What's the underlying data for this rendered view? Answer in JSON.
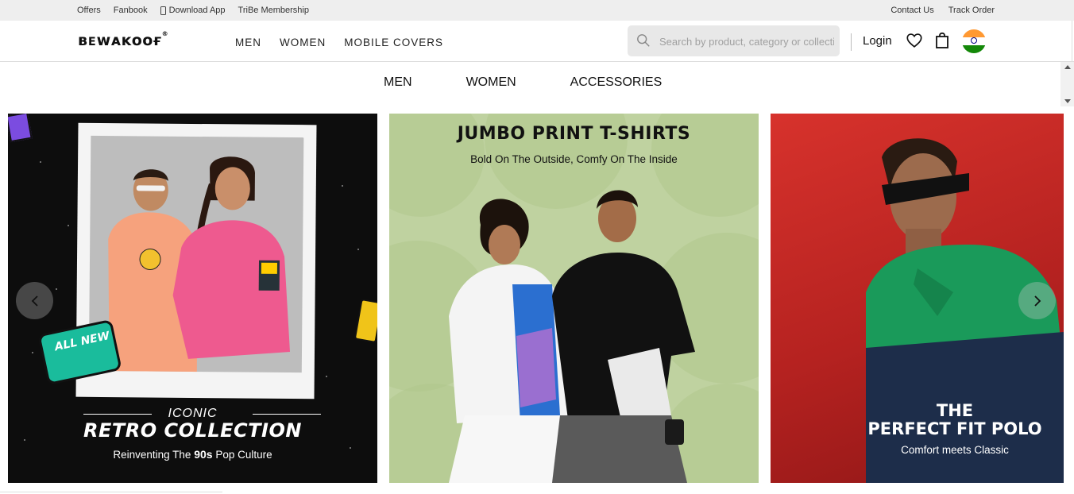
{
  "topbar": {
    "left_links": [
      "Offers",
      "Fanbook",
      "Download App",
      "TriBe Membership"
    ],
    "right_links": [
      "Contact Us",
      "Track Order"
    ]
  },
  "header": {
    "logo": "Bewakoof",
    "logo_mark": "®",
    "nav": [
      "MEN",
      "WOMEN",
      "MOBILE COVERS"
    ],
    "search_placeholder": "Search by product, category or collection",
    "login": "Login",
    "icons": [
      "search-icon",
      "heart-icon",
      "bag-icon",
      "india-flag-icon"
    ]
  },
  "category_nav": [
    "MEN",
    "WOMEN",
    "ACCESSORIES"
  ],
  "banners": [
    {
      "overline": "ICONIC",
      "title": "RETRO COLLECTION",
      "subtitle_pre": "Reinventing The ",
      "subtitle_bold": "90s",
      "subtitle_post": " Pop Culture",
      "sticker": "ALL NEW",
      "bg": "#0d0d0d"
    },
    {
      "title": "JUMBO PRINT T-SHIRTS",
      "subtitle": "Bold On The Outside, Comfy On The Inside",
      "bg": "#bfd2a0"
    },
    {
      "title_line1": "THE",
      "title_line2": "PERFECT FIT POLO",
      "subtitle": "Comfort meets Classic",
      "bg": "#c62a26"
    }
  ],
  "carousel": {
    "prev_icon": "chevron-left-icon",
    "next_icon": "chevron-right-icon"
  }
}
